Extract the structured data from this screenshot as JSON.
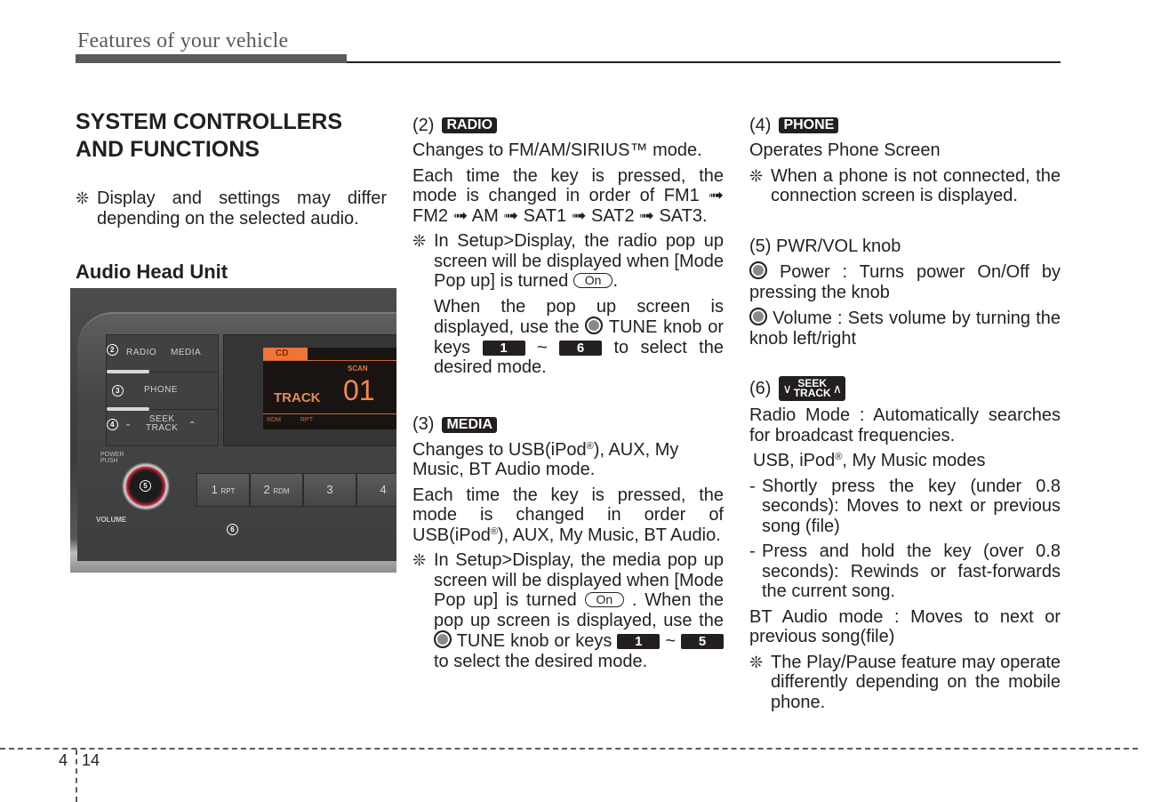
{
  "header": {
    "title": "Features of your vehicle"
  },
  "col1": {
    "title_line1": "SYSTEM CONTROLLERS",
    "title_line2": "AND FUNCTIONS",
    "note_mark": "❊",
    "note": "Display and settings may differ depending on the selected audio.",
    "subtitle": "Audio Head Unit"
  },
  "head_unit": {
    "buttons": [
      "RADIO",
      "MEDIA",
      "PHONE",
      "SEEK",
      "TRACK"
    ],
    "callouts": [
      "2",
      "3",
      "4",
      "5",
      "6"
    ],
    "display": {
      "source": "CD",
      "scan": "SCAN",
      "track_label": "TRACK",
      "track_number": "01",
      "rdm": "RDM",
      "rpt": "RPT"
    },
    "labels": {
      "power": "POWER",
      "push": "PUSH",
      "volume": "VOLUME"
    },
    "presets": [
      {
        "num": "1",
        "sub": "RPT"
      },
      {
        "num": "2",
        "sub": "RDM"
      },
      {
        "num": "3",
        "sub": ""
      },
      {
        "num": "4",
        "sub": ""
      }
    ]
  },
  "radio": {
    "num": "(2)",
    "badge": "RADIO",
    "p1": "Changes to FM/AM/SIRIUS™ mode.",
    "p2": "Each time the key is pressed, the mode is changed in order of FM1 ➟ FM2 ➟ AM ➟ SAT1 ➟ SAT2 ➟ SAT3.",
    "note_a": "In Setup>Display, the radio pop up screen will be displayed when [Mode Pop up] is turned",
    "on_label": "On",
    "note_b1": "When the pop up screen is displayed, use the",
    "note_b2": "TUNE knob or keys",
    "key_from": "1",
    "tilde": "~",
    "key_to": "6",
    "note_b3": "to select the desired mode."
  },
  "media": {
    "num": "(3)",
    "badge": "MEDIA",
    "p1a": "Changes to USB(iPod",
    "reg": "®",
    "p1b": "), AUX, My Music, BT Audio mode.",
    "p2a": "Each time the key is pressed, the mode is changed in order of USB(iPod",
    "p2b": "), AUX, My Music, BT Audio.",
    "note_a": "In Setup>Display, the media pop up screen will be displayed when [Mode Pop up] is turned",
    "on_label": "On",
    "note_b1": "When the pop up screen is displayed, use the",
    "note_b2": "TUNE knob or keys",
    "key_from": "1",
    "tilde": "~",
    "key_to": "5",
    "note_b3": "to select the desired mode."
  },
  "phone": {
    "num": "(4)",
    "badge": "PHONE",
    "p1": "Operates Phone Screen",
    "note": "When a phone is not connected, the connection screen is displayed."
  },
  "pwr": {
    "title": "(5) PWR/VOL knob",
    "power": "Power : Turns power On/Off by pressing the knob",
    "volume": "Volume : Sets volume by turning the knob left/right"
  },
  "seek": {
    "num": "(6)",
    "badge_top": "SEEK",
    "badge_bottom": "TRACK",
    "radio_mode": "Radio Mode : Automatically searches for broadcast frequencies.",
    "usb_a": "USB, iPod",
    "usb_b": ", My Music modes",
    "bullet1": "Shortly press the key (under 0.8 seconds): Moves to next or previous song (file)",
    "bullet2": "Press and hold the key (over 0.8 seconds): Rewinds or fast-forwards the current song.",
    "bt": "BT Audio mode : Moves to next or previous song(file)",
    "note": "The Play/Pause feature may operate differently depending on the mobile phone."
  },
  "footer": {
    "chapter": "4",
    "page": "14"
  }
}
